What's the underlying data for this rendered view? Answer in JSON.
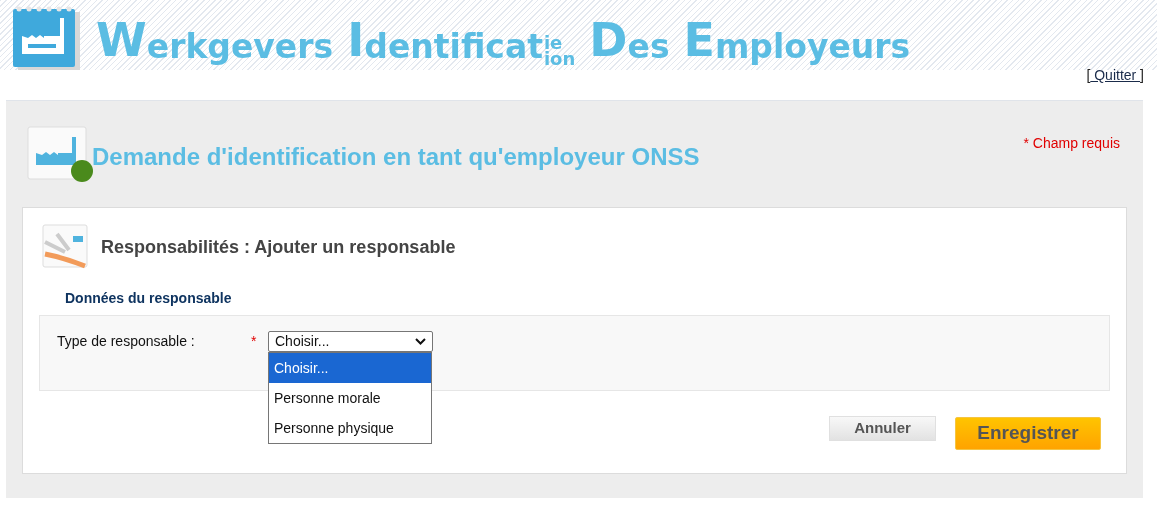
{
  "header": {
    "logo_words": [
      {
        "text": "Werkgevers"
      },
      {
        "text": "Identificat",
        "stack_top": "ie",
        "stack_bottom": "ion"
      },
      {
        "text": "Des"
      },
      {
        "text": "Employeurs"
      }
    ],
    "quit_link": {
      "open": "[",
      "label": " Quitter ",
      "close": "]"
    }
  },
  "page_title": "Demande d'identification en tant qu'employeur ONSS",
  "required_note": "* Champ requis",
  "section_title": "Responsabilités : Ajouter un responsable",
  "group_title": "Données du responsable",
  "field": {
    "label": "Type de responsable :",
    "required_mark": "*",
    "value": "Choisir...",
    "expanded": true,
    "options": [
      {
        "label": "Choisir...",
        "selected": true
      },
      {
        "label": "Personne morale",
        "selected": false
      },
      {
        "label": "Personne physique",
        "selected": false
      }
    ]
  },
  "buttons": [
    {
      "kind": "secondary",
      "label": "Annuler"
    },
    {
      "kind": "primary",
      "label": "Enregistrer"
    }
  ]
}
